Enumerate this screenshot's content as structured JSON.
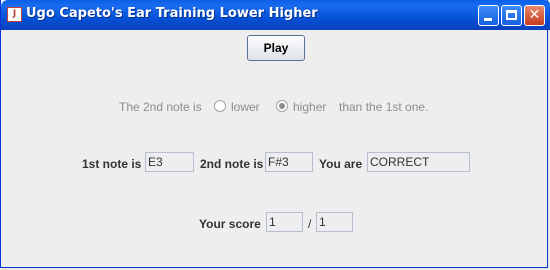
{
  "window": {
    "title": "Ugo Capeto's Ear Training Lower Higher",
    "app_icon": "java-icon",
    "controls": {
      "minimize": "minimize-icon",
      "maximize": "maximize-icon",
      "close": "close-icon",
      "close_glyph": "✕"
    }
  },
  "play": {
    "label": "Play"
  },
  "question": {
    "prefix": "The 2nd note is",
    "options": [
      {
        "label": "lower",
        "selected": false
      },
      {
        "label": "higher",
        "selected": true
      }
    ],
    "suffix": "than the 1st one."
  },
  "notes": {
    "first_label": "1st note is",
    "first_value": "E3",
    "second_label": "2nd note is",
    "second_value": "F#3",
    "result_label": "You are",
    "result_value": "CORRECT"
  },
  "score": {
    "label": "Your score",
    "correct": "1",
    "separator": "/",
    "total": "1"
  },
  "colors": {
    "titlebar": "#0552d6",
    "disabled_text": "#8c8c8c",
    "background": "#eeeeee"
  }
}
